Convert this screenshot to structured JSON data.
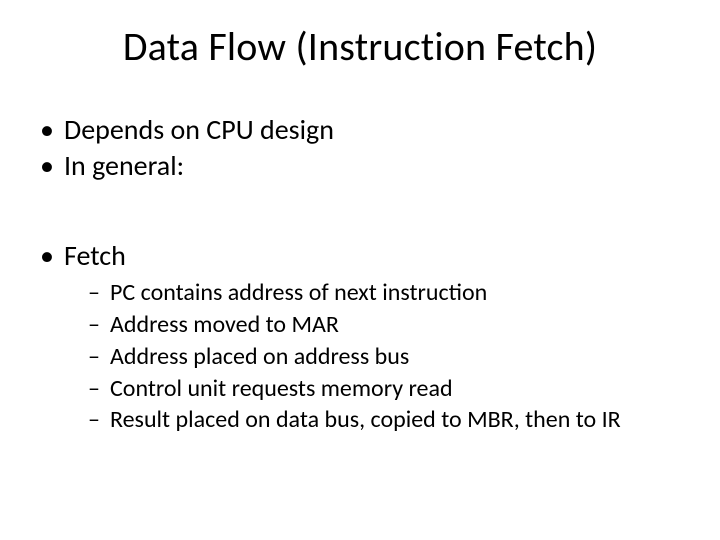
{
  "title": "Data Flow (Instruction Fetch)",
  "bullets": {
    "b0": "Depends on CPU design",
    "b1": "In general:",
    "b2": "Fetch",
    "sub": {
      "s0": "PC contains address of next instruction",
      "s1": "Address moved to MAR",
      "s2": "Address placed on address bus",
      "s3": "Control unit requests memory read",
      "s4": "Result placed on data bus, copied to MBR, then to IR"
    }
  }
}
